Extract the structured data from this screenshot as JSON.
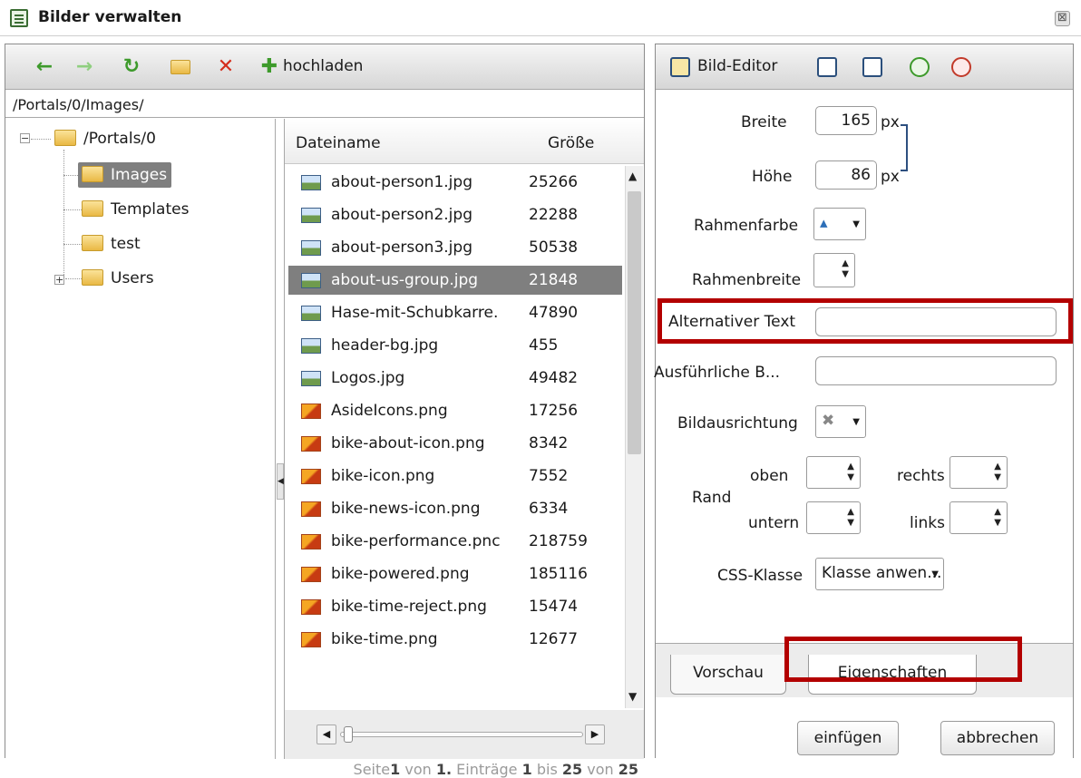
{
  "window": {
    "title": "Bilder verwalten",
    "close_glyph": "⊠"
  },
  "toolbar": {
    "icons": [
      "back-arrow-icon",
      "forward-arrow-icon",
      "refresh-icon",
      "new-folder-icon",
      "delete-icon",
      "upload-plus-icon"
    ],
    "upload_label": "hochladen"
  },
  "path": "/Portals/0/Images/",
  "tree": {
    "root": "/Portals/0",
    "items": [
      {
        "label": "Images",
        "selected": true
      },
      {
        "label": "Templates",
        "selected": false
      },
      {
        "label": "test",
        "selected": false
      },
      {
        "label": "Users",
        "selected": false
      }
    ]
  },
  "filelist": {
    "header_name": "Dateiname",
    "header_size": "Größe",
    "files": [
      {
        "name": "about-person1.jpg",
        "size": "25266",
        "type": "jpg"
      },
      {
        "name": "about-person2.jpg",
        "size": "22288",
        "type": "jpg"
      },
      {
        "name": "about-person3.jpg",
        "size": "50538",
        "type": "jpg"
      },
      {
        "name": "about-us-group.jpg",
        "size": "21848",
        "type": "jpg",
        "selected": true
      },
      {
        "name": "Hase-mit-Schubkarre.",
        "size": "47890",
        "type": "jpg"
      },
      {
        "name": "header-bg.jpg",
        "size": "455",
        "type": "jpg"
      },
      {
        "name": "Logos.jpg",
        "size": "49482",
        "type": "jpg"
      },
      {
        "name": "AsideIcons.png",
        "size": "17256",
        "type": "png"
      },
      {
        "name": "bike-about-icon.png",
        "size": "8342",
        "type": "png"
      },
      {
        "name": "bike-icon.png",
        "size": "7552",
        "type": "png"
      },
      {
        "name": "bike-news-icon.png",
        "size": "6334",
        "type": "png"
      },
      {
        "name": "bike-performance.pnc",
        "size": "218759",
        "type": "png"
      },
      {
        "name": "bike-powered.png",
        "size": "185116",
        "type": "png"
      },
      {
        "name": "bike-time-reject.png",
        "size": "15474",
        "type": "png"
      },
      {
        "name": "bike-time.png",
        "size": "12677",
        "type": "png"
      }
    ],
    "pager": {
      "seite": "Seite",
      "page": "1",
      "von1": "von",
      "total_pages": "1.",
      "eintraege": "Einträge",
      "from": "1",
      "bis": "bis",
      "to": "25",
      "von2": "von",
      "total": "25"
    }
  },
  "editor": {
    "toolbar_label": "Bild-Editor",
    "toolbar_icons": [
      "bild-editor-icon",
      "fit-icon",
      "center-icon",
      "zoom-in-icon",
      "zoom-out-icon"
    ],
    "breite_label": "Breite",
    "breite_value": "165",
    "unit": "px",
    "hoehe_label": "Höhe",
    "hoehe_value": "86",
    "rahmenfarbe_label": "Rahmenfarbe",
    "rahmenbreite_label": "Rahmenbreite",
    "alt_text_label": "Alternativer Text",
    "alt_text_value": "",
    "desc_label": "Ausführliche B...",
    "desc_value": "",
    "bildausrichtung_label": "Bildausrichtung",
    "rand_label": "Rand",
    "oben_label": "oben",
    "rechts_label": "rechts",
    "unten_label": "untern",
    "links_label": "links",
    "css_label": "CSS-Klasse",
    "css_value": "Klasse anwen...",
    "tabs": [
      "Vorschau",
      "Eigenschaften"
    ],
    "active_tab": "Eigenschaften",
    "insert_label": "einfügen",
    "cancel_label": "abbrechen"
  },
  "colors": {
    "highlight": "#b30000",
    "selected_bg": "#7f7f7f"
  }
}
